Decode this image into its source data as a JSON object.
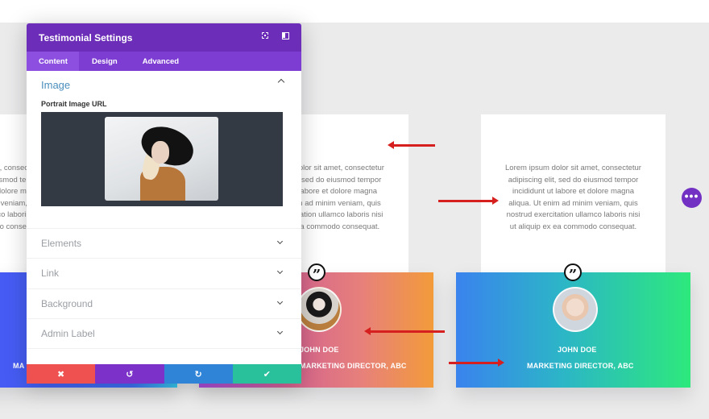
{
  "modal": {
    "title": "Testimonial Settings",
    "icons": {
      "expand": "expand-icon",
      "sidebar": "sidebar-toggle-icon"
    },
    "tabs": [
      {
        "label": "Content",
        "active": true
      },
      {
        "label": "Design",
        "active": false
      },
      {
        "label": "Advanced",
        "active": false
      }
    ],
    "open_section": {
      "title": "Image",
      "field_label": "Portrait Image URL"
    },
    "sections": [
      {
        "label": "Elements"
      },
      {
        "label": "Link"
      },
      {
        "label": "Background"
      },
      {
        "label": "Admin Label"
      }
    ],
    "footer": {
      "cancel": "✖",
      "undo": "↺",
      "redo": "↻",
      "save": "✔"
    }
  },
  "testimonials": {
    "body_lines": [
      "Lorem ipsum dolor sit amet, consectetur",
      "adipiscing elit, sed do eiusmod tempor",
      "incididunt ut labore et dolore magna",
      "aliqua. Ut enim ad minim veniam, quis",
      "nostrud exercitation ullamco laboris nisi",
      "ut aliquip ex ea commodo consequat."
    ],
    "mid_name": "JOHN DOE",
    "mid_role": "MARKETING DIRECTOR, ABC",
    "right_name": "JOHN DOE",
    "right_role": "MARKETING DIRECTOR, ABC",
    "left_role": "MA",
    "quote_glyph": "”"
  },
  "more_button": "•••",
  "colors": {
    "modal_header": "#6c2eb8",
    "tabs_bar": "#7d3dd3",
    "cancel": "#ef5050",
    "undo": "#7c31c9",
    "redo": "#2f84d8",
    "save": "#29c09c",
    "arrow": "#d61f1f"
  }
}
